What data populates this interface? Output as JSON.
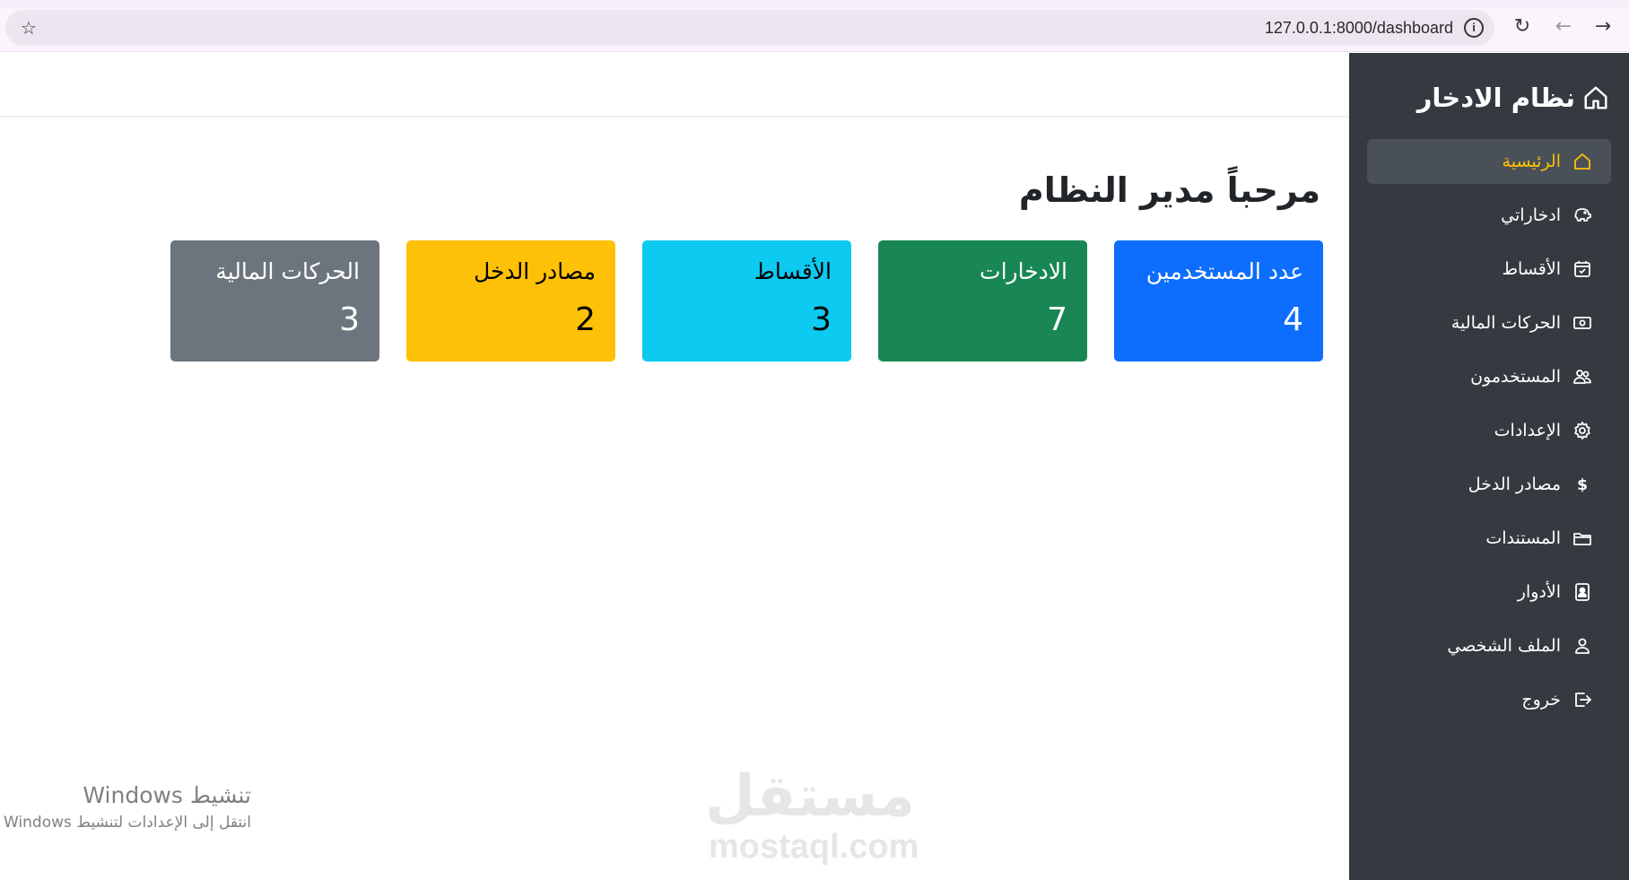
{
  "browser": {
    "url": "127.0.0.1:8000/dashboard",
    "icons": {
      "bookmark": "star-icon",
      "site_info": "info-icon",
      "reload": "reload-icon",
      "back": "back-arrow-icon",
      "forward": "forward-arrow-icon"
    }
  },
  "sidebar": {
    "brand": "نظام الادخار",
    "brand_icon": "home-icon",
    "active_color": "#ffc107",
    "items": [
      {
        "label": "الرئيسية",
        "icon": "home-icon",
        "active": true
      },
      {
        "label": "ادخاراتي",
        "icon": "piggy-bank-icon",
        "active": false
      },
      {
        "label": "الأقساط",
        "icon": "calendar-check-icon",
        "active": false
      },
      {
        "label": "الحركات المالية",
        "icon": "cash-icon",
        "active": false
      },
      {
        "label": "المستخدمون",
        "icon": "users-icon",
        "active": false
      },
      {
        "label": "الإعدادات",
        "icon": "gear-icon",
        "active": false
      },
      {
        "label": "مصادر الدخل",
        "icon": "dollar-icon",
        "active": false
      },
      {
        "label": "المستندات",
        "icon": "folder-icon",
        "active": false
      },
      {
        "label": "الأدوار",
        "icon": "person-badge-icon",
        "active": false
      },
      {
        "label": "الملف الشخصي",
        "icon": "person-icon",
        "active": false
      },
      {
        "label": "خروج",
        "icon": "logout-icon",
        "active": false
      }
    ]
  },
  "main": {
    "welcome": "مرحباً مدير النظام",
    "cards": [
      {
        "label": "عدد المستخدمين",
        "value": "4",
        "color": "#0d6efd",
        "text_color": "#ffffff"
      },
      {
        "label": "الادخارات",
        "value": "7",
        "color": "#198754",
        "text_color": "#ffffff"
      },
      {
        "label": "الأقساط",
        "value": "3",
        "color": "#0dcaf0",
        "text_color": "#000000"
      },
      {
        "label": "مصادر الدخل",
        "value": "2",
        "color": "#ffc107",
        "text_color": "#000000"
      },
      {
        "label": "الحركات المالية",
        "value": "3",
        "color": "#6c757d",
        "text_color": "#ffffff"
      }
    ]
  },
  "watermarks": {
    "windows_title": "تنشيط Windows",
    "windows_sub": "انتقل إلى الإعدادات لتنشيط Windows",
    "logo_ar": "مستقل",
    "logo_en": "mostaql.com"
  }
}
